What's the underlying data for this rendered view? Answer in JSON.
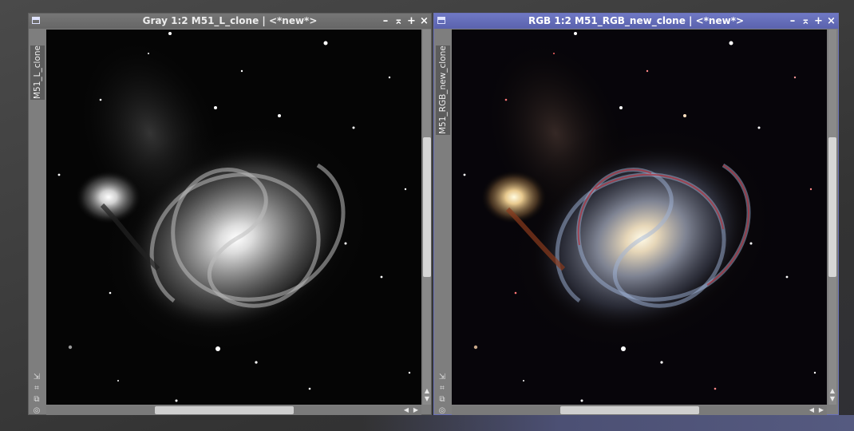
{
  "windows": [
    {
      "title": "Gray 1:2 M51_L_clone | <*new*>",
      "side_tab": "M51_L_clone",
      "mode": "gray"
    },
    {
      "title": "RGB 1:2 M51_RGB_new_clone | <*new*>",
      "side_tab": "M51_RGB_new_clone",
      "mode": "rgb"
    }
  ],
  "title_buttons": [
    "minimize-icon",
    "shade-icon",
    "maximize-icon",
    "close-icon"
  ],
  "colors": {
    "active_titlebar": "#5f67b3",
    "inactive_titlebar": "#6e6e6e",
    "window_frame": "#7e7e7e",
    "canvas_bg": "#000000"
  }
}
